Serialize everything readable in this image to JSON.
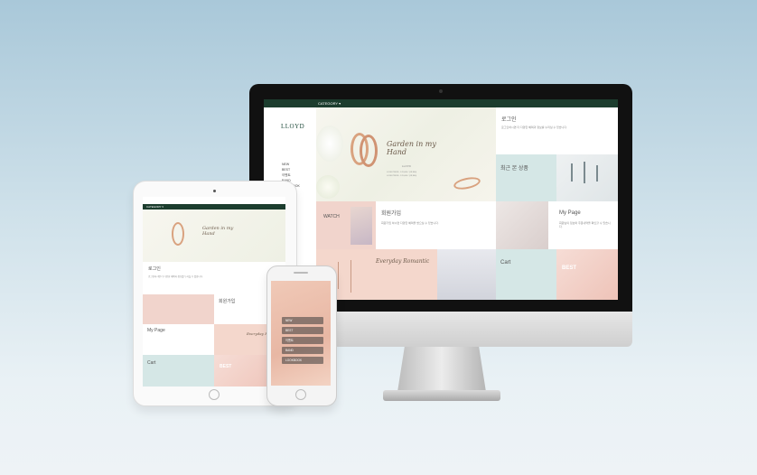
{
  "category_label": "CATEGORY ▾",
  "brand": "LLOYD",
  "side_menu": [
    "NEW",
    "BEST",
    "이벤트",
    "BAND",
    "LOOKBOOK"
  ],
  "hero": {
    "script": "Garden in my Hand",
    "brand": "LLOYD",
    "price1": "LOOK PRICE : 170,000 / (19,900)",
    "price2": "LOOK PRICE : 170,000 / (19,900)"
  },
  "tiles": {
    "login": {
      "title": "로그인",
      "desc": "로그인하시면 더 다양한 혜택과 정보를 누리실 수 있습니다."
    },
    "recent": {
      "title": "최근 본 상품"
    },
    "join": {
      "title": "회원가입",
      "desc": "회원가입 하시면 다양한 혜택을 받으실 수 있습니다."
    },
    "watch": {
      "title": "WATCH"
    },
    "mypage": {
      "title": "My Page",
      "desc": "회원님의 정보와 주문내역을 확인할 수 있습니다."
    },
    "romance": {
      "script": "Everyday Romantic"
    },
    "cart": {
      "title": "Cart"
    },
    "best": {
      "title": "BEST"
    }
  },
  "phone_menu": [
    "NEW",
    "BEST",
    "이벤트",
    "BAND",
    "LOOKBOOK"
  ],
  "colors": {
    "header_green": "#1c3d2e",
    "mint": "#d5e7e6",
    "blush": "#f1d4cc"
  }
}
